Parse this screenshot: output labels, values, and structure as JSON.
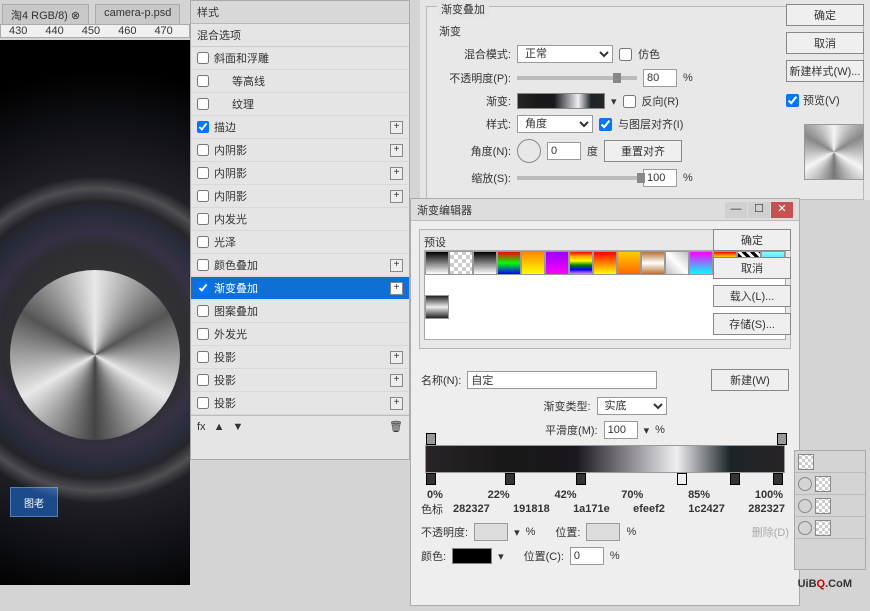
{
  "tabs": [
    "淘4 RGB/8) ⊗",
    "camera-p.psd"
  ],
  "ruler": [
    "430",
    "440",
    "450",
    "460",
    "470"
  ],
  "styles": {
    "header": "样式",
    "subheader": "混合选项",
    "items": [
      {
        "label": "斜面和浮雕",
        "checked": false,
        "plus": false
      },
      {
        "label": "等高线",
        "checked": false,
        "plus": false,
        "indent": true
      },
      {
        "label": "纹理",
        "checked": false,
        "plus": false,
        "indent": true
      },
      {
        "label": "描边",
        "checked": true,
        "plus": true
      },
      {
        "label": "内阴影",
        "checked": false,
        "plus": true
      },
      {
        "label": "内阴影",
        "checked": false,
        "plus": true
      },
      {
        "label": "内阴影",
        "checked": false,
        "plus": true
      },
      {
        "label": "内发光",
        "checked": false,
        "plus": false
      },
      {
        "label": "光泽",
        "checked": false,
        "plus": false
      },
      {
        "label": "颜色叠加",
        "checked": false,
        "plus": true
      },
      {
        "label": "渐变叠加",
        "checked": true,
        "plus": true,
        "selected": true
      },
      {
        "label": "图案叠加",
        "checked": false,
        "plus": false
      },
      {
        "label": "外发光",
        "checked": false,
        "plus": false
      },
      {
        "label": "投影",
        "checked": false,
        "plus": true
      },
      {
        "label": "投影",
        "checked": false,
        "plus": true
      },
      {
        "label": "投影",
        "checked": false,
        "plus": true
      }
    ],
    "fx": "fx"
  },
  "gradOverlay": {
    "group": "渐变叠加",
    "sub": "渐变",
    "blendLabel": "混合模式:",
    "blendValue": "正常",
    "dither": "仿色",
    "opacityLabel": "不透明度(P):",
    "opacityValue": "80",
    "pct": "%",
    "gradLabel": "渐变:",
    "reverse": "反向(R)",
    "styleLabel": "样式:",
    "styleValue": "角度",
    "alignLayer": "与图层对齐(I)",
    "angleLabel": "角度(N):",
    "angleValue": "0",
    "deg": "度",
    "reset": "重置对齐",
    "scaleLabel": "缩放(S):",
    "scaleValue": "100"
  },
  "sideButtons": {
    "ok": "确定",
    "cancel": "取消",
    "newStyle": "新建样式(W)...",
    "preview": "预览(V)"
  },
  "gradEditor": {
    "title": "渐变编辑器",
    "presets": "预设",
    "ok": "确定",
    "cancel": "取消",
    "load": "载入(L)...",
    "save": "存储(S)...",
    "new": "新建(W)",
    "nameLabel": "名称(N):",
    "nameValue": "自定",
    "typeLabel": "渐变类型:",
    "typeValue": "实底",
    "smoothLabel": "平滑度(M):",
    "smoothValue": "100",
    "pct": "%",
    "stopsLabel": "色标",
    "opLabel": "不透明度:",
    "opPct": "%",
    "locLabel": "位置:",
    "del": "删除(D)",
    "colorLabel": "颜色:",
    "loc2Label": "位置(C):",
    "loc2Value": "0"
  },
  "annotations": {
    "percents": [
      "0%",
      "22%",
      "42%",
      "70%",
      "85%",
      "100%"
    ],
    "colors": [
      "282327",
      "191818",
      "1a171e",
      "efeef2",
      "1c2427",
      "282327"
    ]
  },
  "uibq": {
    "pre": "UiB",
    "red": "Q",
    "suf": ".CoM"
  },
  "watermark": "图老"
}
